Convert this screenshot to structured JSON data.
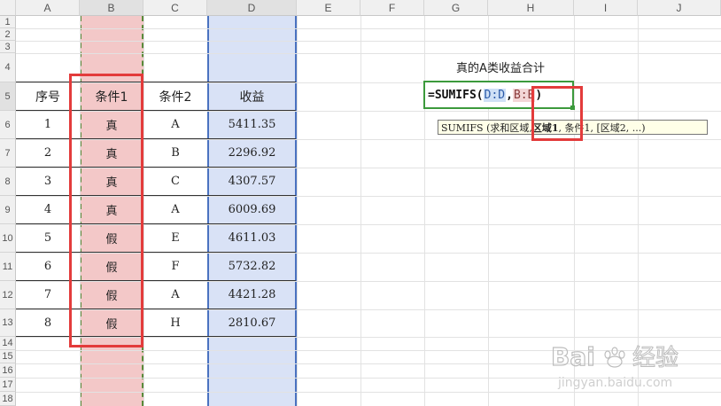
{
  "columns": [
    "A",
    "B",
    "C",
    "D",
    "E",
    "F",
    "G",
    "H",
    "I",
    "J"
  ],
  "rows": [
    "1",
    "2",
    "3",
    "4",
    "5",
    "6",
    "7",
    "8",
    "9",
    "10",
    "11",
    "12",
    "13",
    "14",
    "15",
    "16",
    "17",
    "18"
  ],
  "table": {
    "headers": [
      "序号",
      "条件1",
      "条件2",
      "收益"
    ],
    "rows": [
      [
        "1",
        "真",
        "A",
        "5411.35"
      ],
      [
        "2",
        "真",
        "B",
        "2296.92"
      ],
      [
        "3",
        "真",
        "C",
        "4307.57"
      ],
      [
        "4",
        "真",
        "A",
        "6009.69"
      ],
      [
        "5",
        "假",
        "E",
        "4611.03"
      ],
      [
        "6",
        "假",
        "F",
        "5732.82"
      ],
      [
        "7",
        "假",
        "A",
        "4421.28"
      ],
      [
        "8",
        "假",
        "H",
        "2810.67"
      ]
    ]
  },
  "label_g4": "真的A类收益合计",
  "formula": {
    "prefix": "=SUMIFS(",
    "ref1": "D:D",
    "sep": ", ",
    "ref2": "B:B",
    "suffix": ")"
  },
  "tooltip": {
    "before": "SUMIFS (求和区域, ",
    "bold": "区域1",
    "after": ", 条件1, [区域2, ...)"
  },
  "watermark": {
    "brand_a": "Bai",
    "brand_b": "经验",
    "url": "jingyan.baidu.com"
  },
  "colors": {
    "condition_col": "#f3c8c8",
    "income_col": "#d9e2f6",
    "highlight": "#e33b3b",
    "active_border": "#3c9a3c"
  }
}
